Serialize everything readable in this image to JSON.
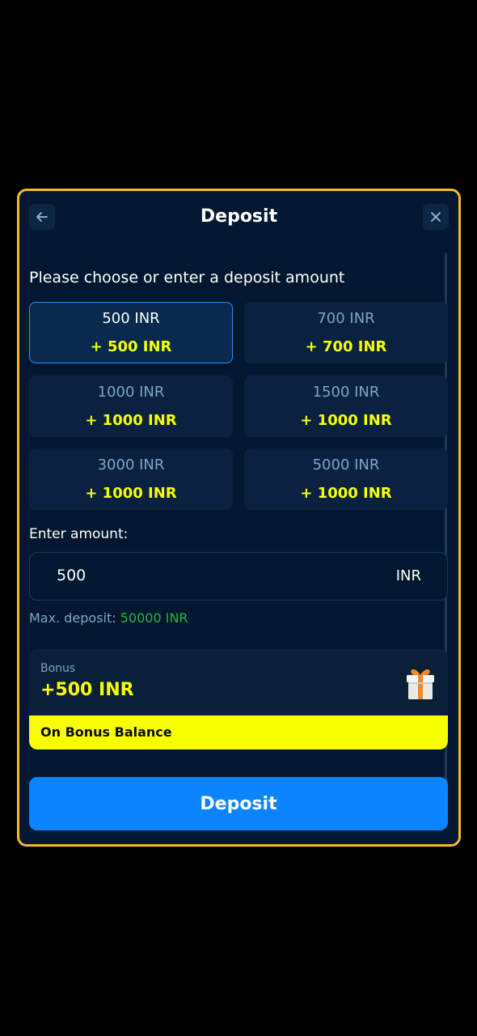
{
  "header": {
    "title": "Deposit",
    "back_icon": "arrow-left-icon",
    "close_icon": "close-icon"
  },
  "prompt": "Please choose or enter a deposit amount",
  "presets": [
    {
      "amount": "500 INR",
      "bonus": "+ 500 INR",
      "selected": true
    },
    {
      "amount": "700 INR",
      "bonus": "+ 700 INR",
      "selected": false
    },
    {
      "amount": "1000 INR",
      "bonus": "+ 1000 INR",
      "selected": false
    },
    {
      "amount": "1500 INR",
      "bonus": "+ 1000 INR",
      "selected": false
    },
    {
      "amount": "3000 INR",
      "bonus": "+ 1000 INR",
      "selected": false
    },
    {
      "amount": "5000 INR",
      "bonus": "+ 1000 INR",
      "selected": false
    }
  ],
  "amount_field": {
    "label": "Enter amount:",
    "value": "500",
    "currency": "INR"
  },
  "max_deposit": {
    "label": "Max. deposit:",
    "value": "50000 INR"
  },
  "bonus": {
    "label": "Bonus",
    "value": "+500 INR",
    "strip": "On Bonus Balance",
    "icon": "gift-icon"
  },
  "deposit_button": "Deposit",
  "colors": {
    "border": "#f5b925",
    "accent": "#0a84ff",
    "bonus_yellow": "#f7ff00",
    "max_green": "#24b33f"
  }
}
